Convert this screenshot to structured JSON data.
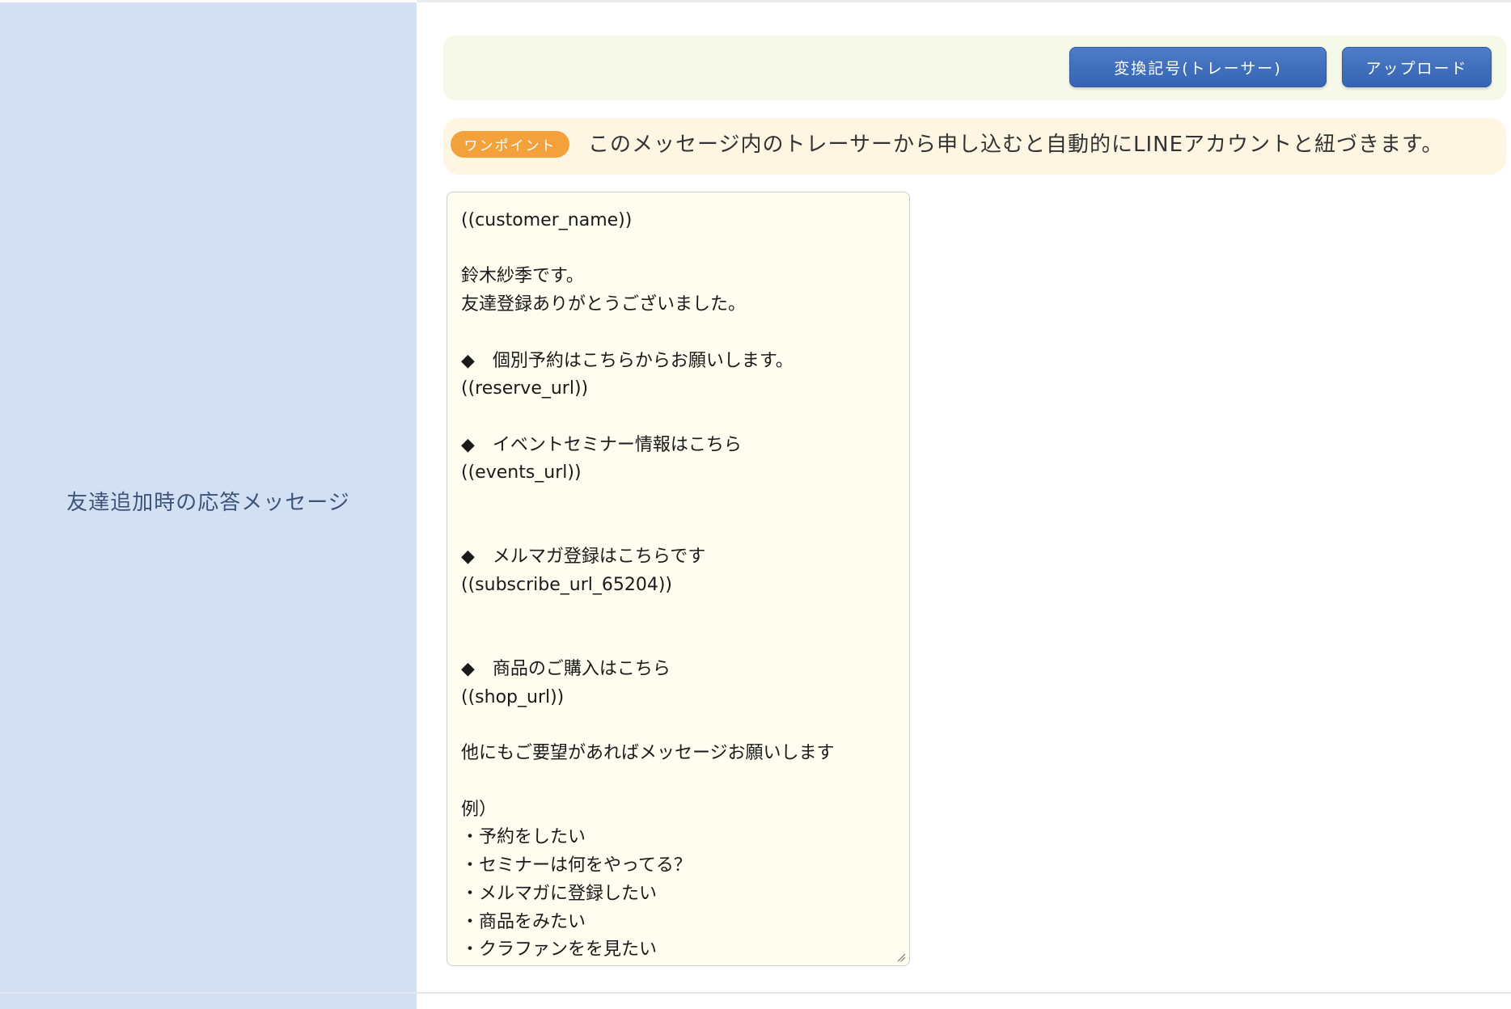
{
  "row_label": "友達追加時の応答メッセージ",
  "toolbar": {
    "convert_button": "変換記号(トレーサー)",
    "upload_button": "アップロード"
  },
  "tip": {
    "badge": "ワンポイント",
    "text": "このメッセージ内のトレーサーから申し込むと自動的にLINEアカウントと紐づきます。"
  },
  "message": {
    "value": "((customer_name))\n\n鈴木紗季です。\n友達登録ありがとうございました。\n\n◆　個別予約はこちらからお願いします。\n((reserve_url))\n\n◆　イベントセミナー情報はこちら\n((events_url))\n\n\n◆　メルマガ登録はこちらです\n((subscribe_url_65204))\n\n\n◆　商品のご購入はこちら\n((shop_url))\n\n他にもご要望があればメッセージお願いします\n\n例）\n・予約をしたい\n・セミナーは何をやってる？\n・メルマガに登録したい\n・商品をみたい\n・クラファンをを見たい"
  },
  "colors": {
    "label_bg": "#d3e0f3",
    "label_text": "#3d5478",
    "toolbar_bg": "#f6f9e9",
    "button_blue": "#3f6fbd",
    "tip_bg": "#fef6e2",
    "badge_orange": "#f2a13b",
    "editor_bg": "#fffdef"
  },
  "icons": {
    "resize": "resize-grip-icon"
  }
}
